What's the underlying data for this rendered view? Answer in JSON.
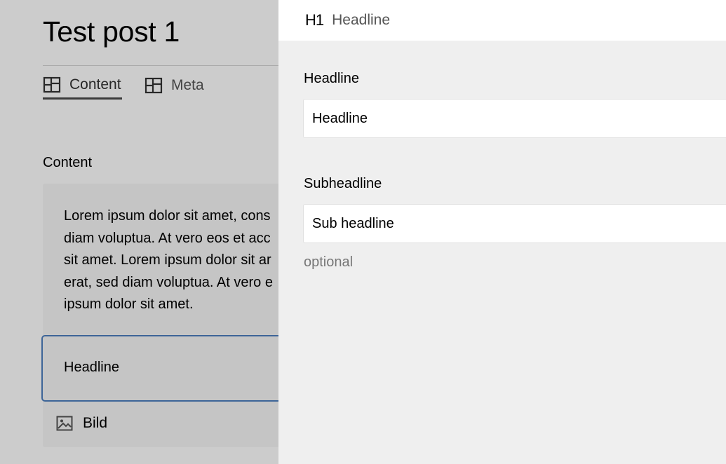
{
  "page": {
    "title": "Test post 1",
    "tabs": [
      {
        "label": "Content",
        "active": true
      },
      {
        "label": "Meta",
        "active": false
      }
    ],
    "section_label": "Content",
    "paragraph_lines": [
      "Lorem ipsum dolor sit amet, cons",
      "diam voluptua. At vero eos et acc",
      "sit amet. Lorem ipsum dolor sit ar",
      "erat, sed diam voluptua. At vero e",
      "ipsum dolor sit amet."
    ],
    "headline_block": "Headline",
    "image_block": "Bild"
  },
  "drawer": {
    "header_icon": "H1",
    "header_title": "Headline",
    "headline_label": "Headline",
    "headline_value": "Headline",
    "subheadline_label": "Subheadline",
    "subheadline_value": "Sub headline",
    "subheadline_hint": "optional"
  },
  "colors": {
    "overlay": "rgba(0,0,0,0.2)",
    "drawer_bg": "#efefef",
    "selected_border": "#4d7fbf"
  }
}
